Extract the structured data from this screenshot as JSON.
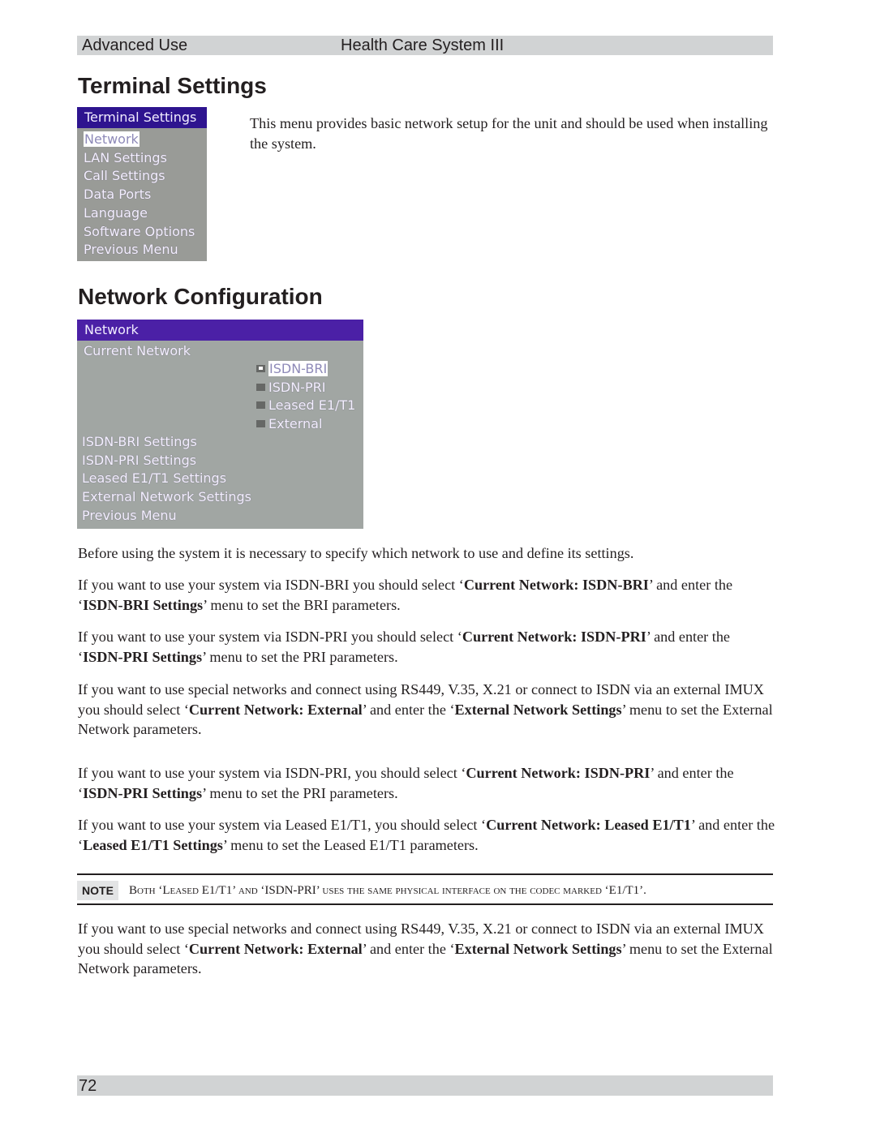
{
  "header": {
    "section": "Advanced Use",
    "product": "Health Care System III"
  },
  "terminal_settings": {
    "heading": "Terminal Settings",
    "menu": {
      "title": "Terminal Settings",
      "items": [
        {
          "label": "Network",
          "selected": true
        },
        {
          "label": "LAN Settings",
          "selected": false
        },
        {
          "label": "Call Settings",
          "selected": false
        },
        {
          "label": "Data Ports",
          "selected": false
        },
        {
          "label": "Language",
          "selected": false
        },
        {
          "label": "Software Options",
          "selected": false
        },
        {
          "label": "Previous Menu",
          "selected": false
        }
      ]
    },
    "description": "This menu provides basic network setup for the unit and should be used when installing the system."
  },
  "network_configuration": {
    "heading": "Network Configuration",
    "menu": {
      "title": "Network",
      "current_network_label": "Current Network",
      "options": [
        {
          "label": "ISDN-BRI",
          "selected": true
        },
        {
          "label": "ISDN-PRI",
          "selected": false
        },
        {
          "label": "Leased E1/T1",
          "selected": false
        },
        {
          "label": "External",
          "selected": false
        }
      ],
      "items": [
        "ISDN-BRI Settings",
        "ISDN-PRI Settings",
        "Leased E1/T1 Settings",
        "External Network Settings",
        "Previous Menu"
      ]
    },
    "paragraphs": {
      "p1": "Before using the system it is necessary to specify which network to use and define its settings.",
      "p2": {
        "a": "If you want to use your system via ISDN-BRI you should select ‘",
        "b": "Current Network: ISDN-BRI",
        "c": "’ and enter the ‘",
        "d": "ISDN-BRI Settings",
        "e": "’ menu to set the BRI parameters."
      },
      "p3": {
        "a": "If you want to use your system via ISDN-PRI  you should select ‘",
        "b": "Current Network: ISDN-PRI",
        "c": "’ and enter the ‘",
        "d": "ISDN-PRI Settings",
        "e": "’ menu to set the PRI parameters."
      },
      "p4": {
        "a": "If you want to use special networks and connect using RS449, V.35, X.21 or connect to ISDN via an external IMUX you should select ‘",
        "b": "Current Network: External",
        "c": "’ and enter the ‘",
        "d": "External Network Settings",
        "e": "’ menu to set the External Network parameters."
      },
      "p5": {
        "a": "If you want to use your system via ISDN-PRI, you should select ‘",
        "b": "Current Network: ISDN-PRI",
        "c": "’ and enter the ‘",
        "d": "ISDN-PRI Settings",
        "e": "’ menu to set the PRI parameters."
      },
      "p6": {
        "a": "If you want to use your system via Leased E1/T1, you should select ‘",
        "b": "Current Network: Leased E1/T1",
        "c": "’ and enter the ‘",
        "d": "Leased E1/T1 Settings",
        "e": "’ menu to set the Leased E1/T1 parameters."
      },
      "p7": {
        "a": "If you want to use special networks and connect using RS449, V.35, X.21 or connect to ISDN via an external IMUX you should select ‘",
        "b": "Current Network: External",
        "c": "’ and enter the ‘",
        "d": "External Network Settings",
        "e": "’ menu to set the External Network parameters."
      }
    },
    "note": {
      "label": "NOTE",
      "text": "Both ‘Leased E1/T1’ and ‘ISDN-PRI’ uses the same physical interface on the codec marked ‘E1/T1’."
    }
  },
  "footer": {
    "page_number": "72"
  },
  "colors": {
    "header_bar": "#d1d3d4",
    "osd_title_bg": "#2e148f",
    "osd_body_bg": "#999b97",
    "text": "#231f20"
  }
}
